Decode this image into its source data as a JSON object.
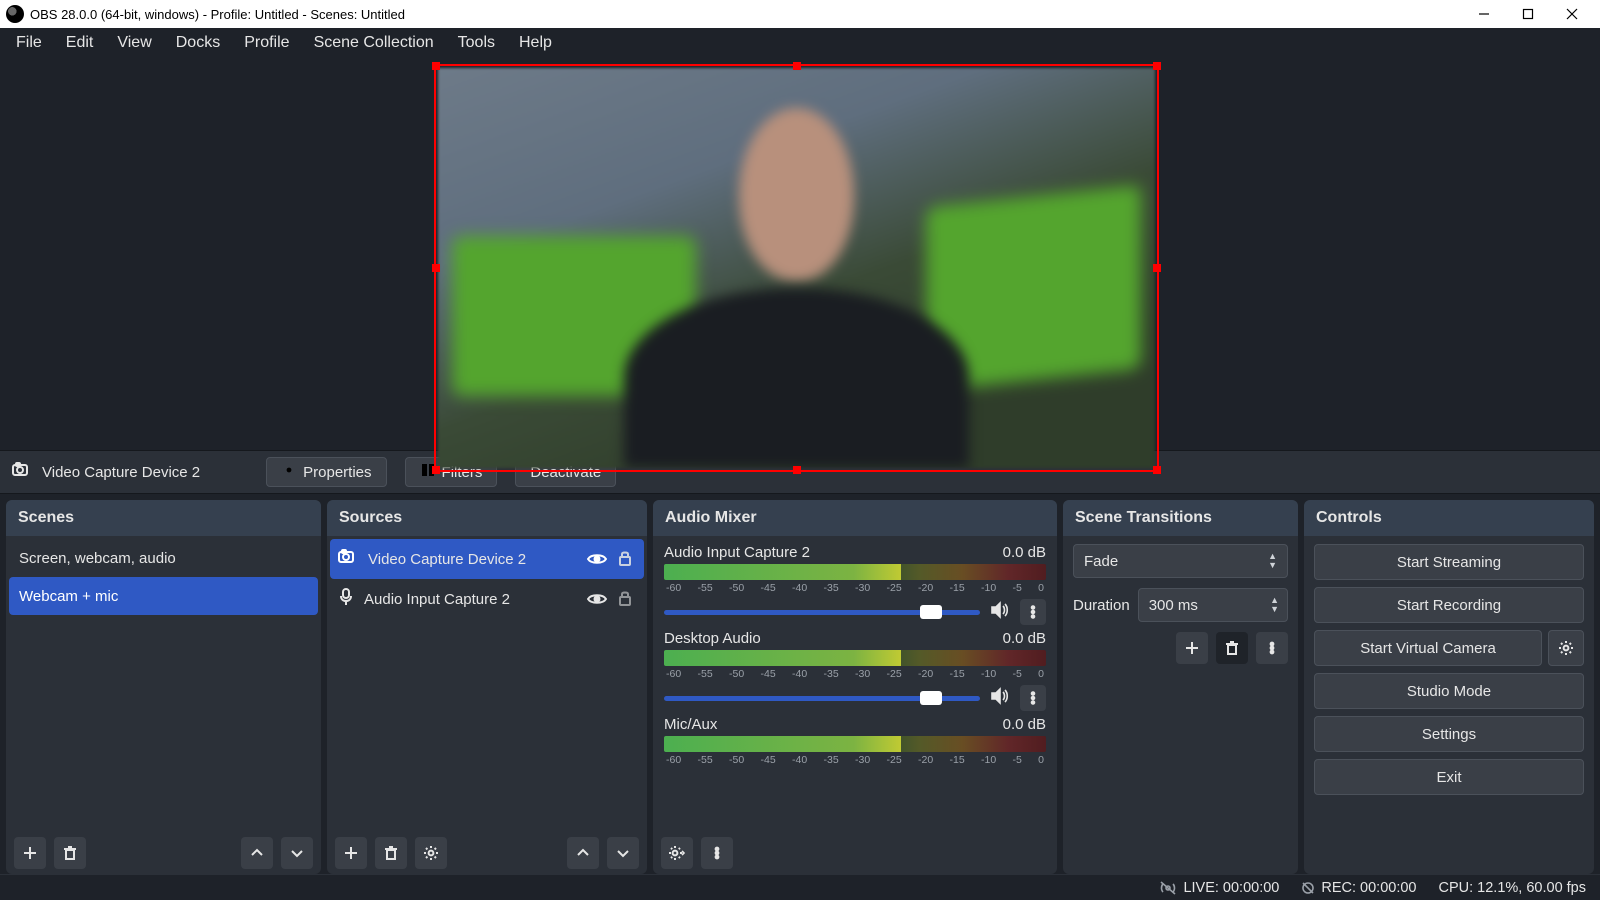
{
  "titlebar": {
    "title": "OBS 28.0.0 (64-bit, windows) - Profile: Untitled - Scenes: Untitled"
  },
  "menu": [
    "File",
    "Edit",
    "View",
    "Docks",
    "Profile",
    "Scene Collection",
    "Tools",
    "Help"
  ],
  "context_toolbar": {
    "source_name": "Video Capture Device 2",
    "properties": "Properties",
    "filters": "Filters",
    "deactivate": "Deactivate"
  },
  "scenes": {
    "title": "Scenes",
    "items": [
      "Screen, webcam, audio",
      "Webcam + mic"
    ],
    "selected": 1
  },
  "sources": {
    "title": "Sources",
    "items": [
      {
        "icon": "camera",
        "label": "Video Capture Device 2",
        "selected": true,
        "locked": true,
        "visible": true
      },
      {
        "icon": "mic",
        "label": "Audio Input Capture 2",
        "selected": false,
        "locked": true,
        "visible": true
      }
    ]
  },
  "mixer": {
    "title": "Audio Mixer",
    "ticks": [
      "-60",
      "-55",
      "-50",
      "-45",
      "-40",
      "-35",
      "-30",
      "-25",
      "-20",
      "-15",
      "-10",
      "-5",
      "0"
    ],
    "channels": [
      {
        "name": "Audio Input Capture 2",
        "level": "0.0 dB",
        "fill": 62,
        "slider": true
      },
      {
        "name": "Desktop Audio",
        "level": "0.0 dB",
        "fill": 62,
        "slider": true
      },
      {
        "name": "Mic/Aux",
        "level": "0.0 dB",
        "fill": 62,
        "slider": false
      }
    ]
  },
  "transitions": {
    "title": "Scene Transitions",
    "selected": "Fade",
    "duration_label": "Duration",
    "duration_value": "300 ms"
  },
  "controls": {
    "title": "Controls",
    "start_streaming": "Start Streaming",
    "start_recording": "Start Recording",
    "start_virtual_camera": "Start Virtual Camera",
    "studio_mode": "Studio Mode",
    "settings": "Settings",
    "exit": "Exit"
  },
  "statusbar": {
    "live": "LIVE: 00:00:00",
    "rec": "REC: 00:00:00",
    "cpu": "CPU: 12.1%, 60.00 fps"
  }
}
